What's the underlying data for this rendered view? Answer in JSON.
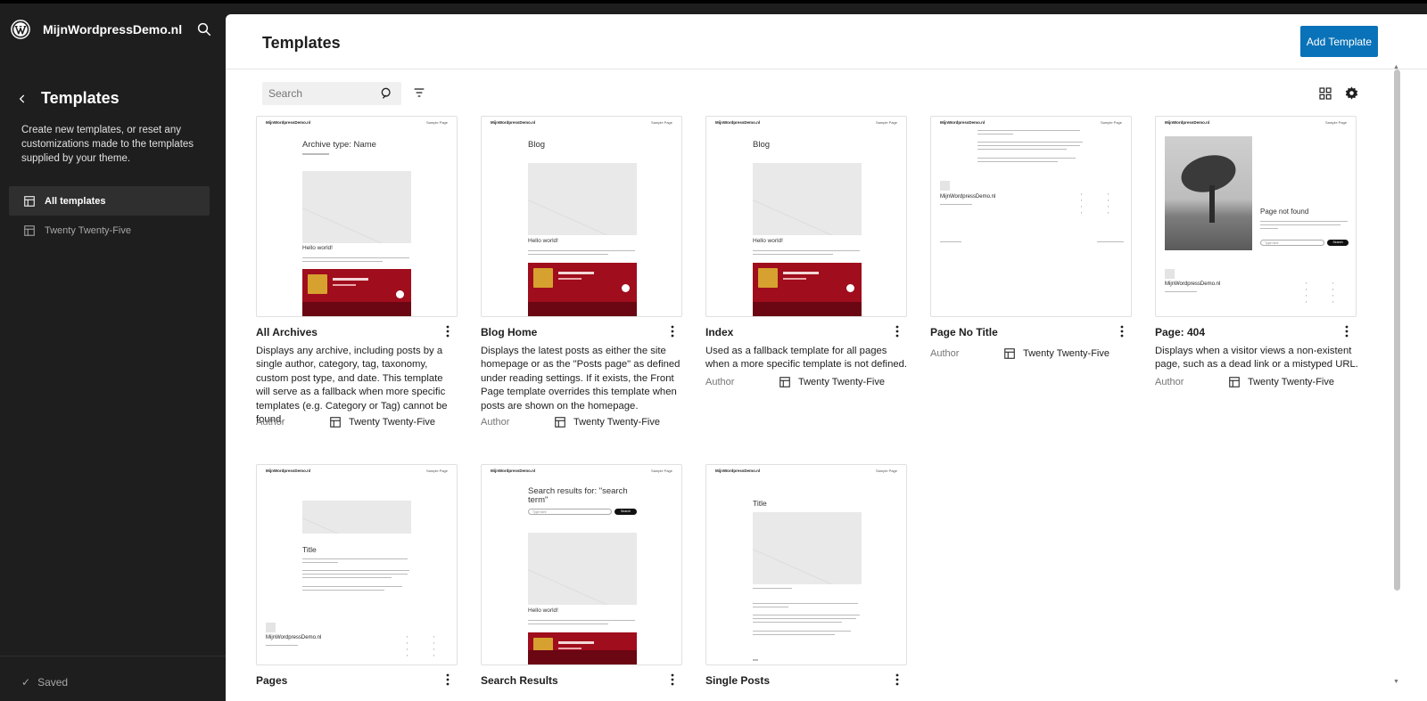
{
  "sidebar": {
    "site_name": "MijnWordpressDemo.nl",
    "title": "Templates",
    "description": "Create new templates, or reset any customizations made to the templates supplied by your theme.",
    "items": [
      {
        "label": "All templates"
      },
      {
        "label": "Twenty Twenty-Five"
      }
    ],
    "saved": "Saved"
  },
  "header": {
    "title": "Templates",
    "add_button": "Add Template"
  },
  "toolbar": {
    "search_placeholder": "Search"
  },
  "preview_text": {
    "site": "MijnWordpressDemo.nl",
    "nav": "Sample Page",
    "archive_heading": "Archive type: Name",
    "blog_heading": "Blog",
    "hello": "Hello world!",
    "page_not_found": "Page not found",
    "title": "Title",
    "search_heading": "Search results for: \"search term\"",
    "search_input": "Type here",
    "search_button": "Search",
    "footer_site": "MijnWordpressDemo.nl"
  },
  "templates": [
    {
      "title": "All Archives",
      "description": "Displays any archive, including posts by a single author, category, tag, taxonomy, custom post type, and date. This template will serve as a fallback when more specific templates (e.g. Category or Tag) cannot be found.",
      "author_label": "Author",
      "theme": "Twenty Twenty-Five"
    },
    {
      "title": "Blog Home",
      "description": "Displays the latest posts as either the site homepage or as the \"Posts page\" as defined under reading settings. If it exists, the Front Page template overrides this template when posts are shown on the homepage.",
      "author_label": "Author",
      "theme": "Twenty Twenty-Five"
    },
    {
      "title": "Index",
      "description": "Used as a fallback template for all pages when a more specific template is not defined.",
      "author_label": "Author",
      "theme": "Twenty Twenty-Five"
    },
    {
      "title": "Page No Title",
      "description": "",
      "author_label": "Author",
      "theme": "Twenty Twenty-Five"
    },
    {
      "title": "Page: 404",
      "description": "Displays when a visitor views a non-existent page, such as a dead link or a mistyped URL.",
      "author_label": "Author",
      "theme": "Twenty Twenty-Five"
    },
    {
      "title": "Pages",
      "description": "",
      "author_label": "",
      "theme": ""
    },
    {
      "title": "Search Results",
      "description": "",
      "author_label": "",
      "theme": ""
    },
    {
      "title": "Single Posts",
      "description": "",
      "author_label": "",
      "theme": ""
    }
  ],
  "colors": {
    "accent": "#0a72b8",
    "sidebar_bg": "#1e1e1e",
    "preview_red": "#a00d1c"
  },
  "icons": [
    "wordpress-logo",
    "search-icon",
    "chevron-left-icon",
    "layout-icon",
    "filter-icon",
    "grid-view-icon",
    "gear-icon",
    "more-vertical-icon",
    "check-icon"
  ]
}
